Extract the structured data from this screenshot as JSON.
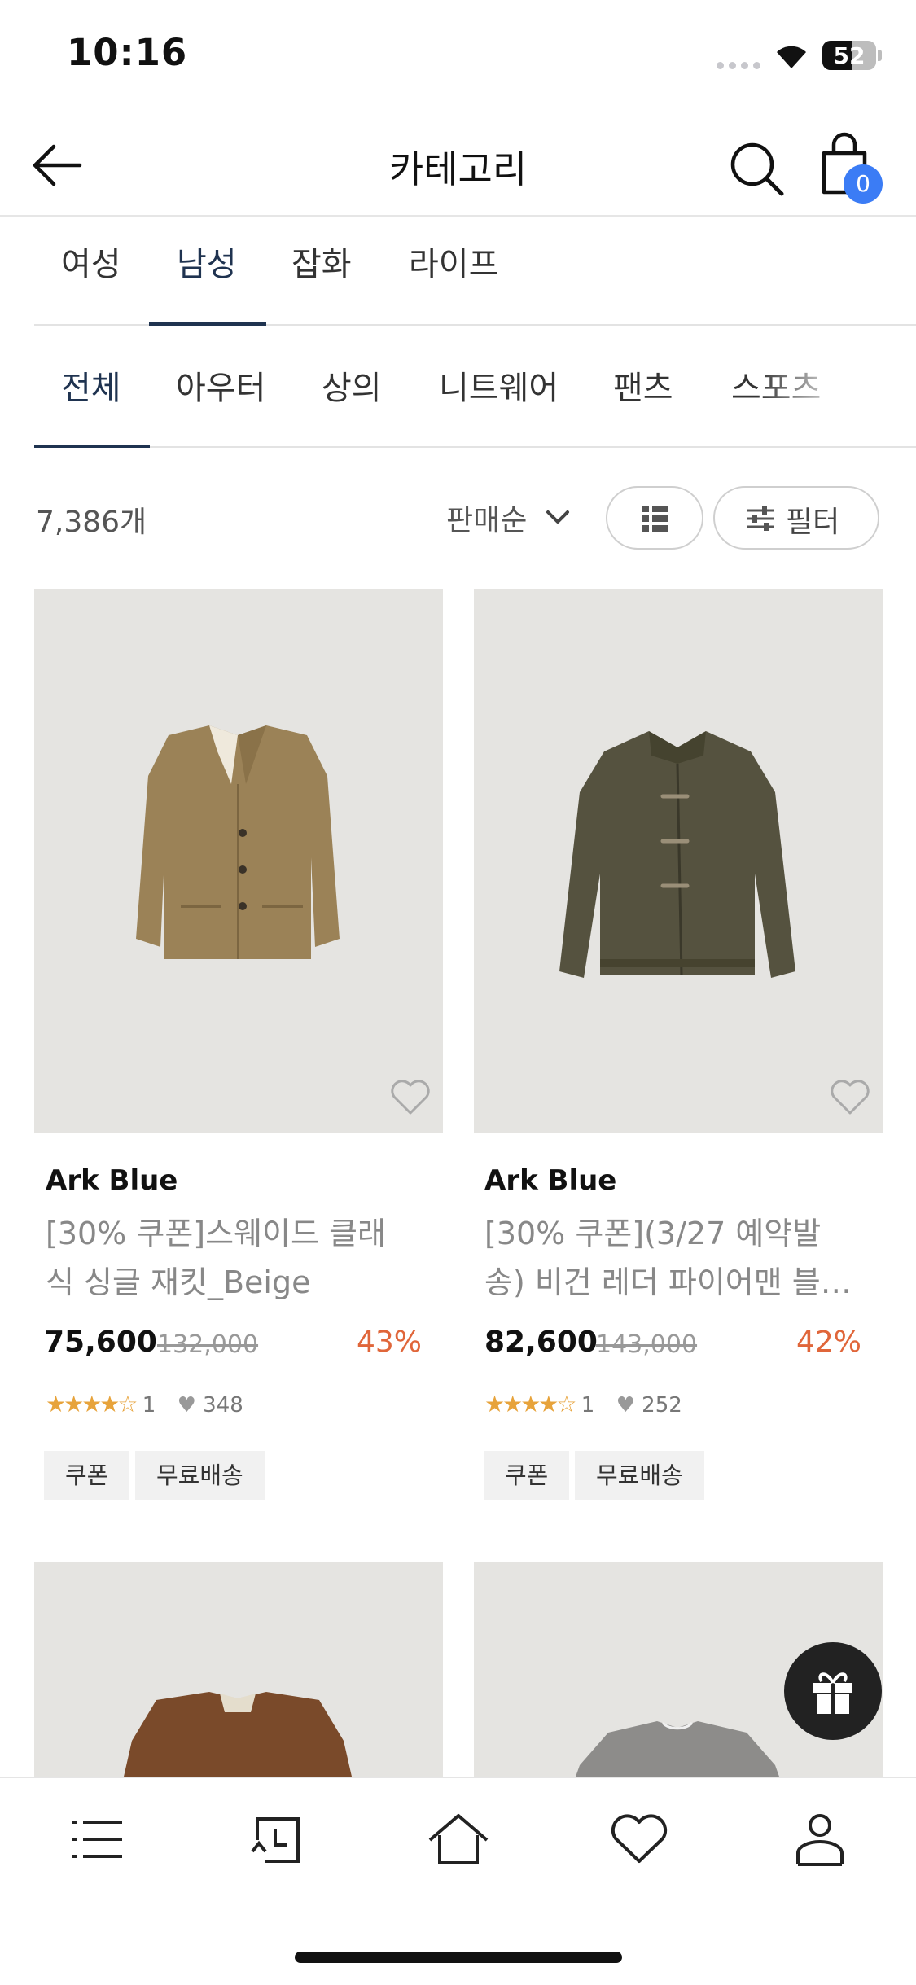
{
  "status_bar": {
    "time": "10:16",
    "battery": "52"
  },
  "header": {
    "title": "카테고리",
    "cart_count": "0"
  },
  "gender_tabs": [
    {
      "label": "여성"
    },
    {
      "label": "남성",
      "active": true
    },
    {
      "label": "잡화"
    },
    {
      "label": "라이프"
    }
  ],
  "category_tabs": [
    {
      "label": "전체",
      "active": true
    },
    {
      "label": "아우터"
    },
    {
      "label": "상의"
    },
    {
      "label": "니트웨어"
    },
    {
      "label": "팬츠"
    },
    {
      "label": "스포츠"
    }
  ],
  "toolbar": {
    "count": "7,386개",
    "sort_label": "판매순",
    "filter_label": "필터"
  },
  "products": [
    {
      "brand": "Ark Blue",
      "name_line1": "[30% 쿠폰]스웨이드 클래",
      "name_line2": "식 싱글 재킷_Beige",
      "price": "75,600",
      "original_price": "132,000",
      "discount": "43%",
      "stars": "★★★★☆",
      "review_count": "1",
      "likes": "348",
      "tags": [
        "쿠폰",
        "무료배송"
      ],
      "image": "beige-suede-blazer"
    },
    {
      "brand": "Ark Blue",
      "name_line1": "[30% 쿠폰](3/27 예약발",
      "name_line2": "송) 비건 레더 파이어맨 블…",
      "price": "82,600",
      "original_price": "143,000",
      "discount": "42%",
      "stars": "★★★★☆",
      "review_count": "1",
      "likes": "252",
      "tags": [
        "쿠폰",
        "무료배송"
      ],
      "image": "olive-fireman-jacket"
    },
    {
      "image": "brown-suede-jacket"
    },
    {
      "image": "grey-cardigan"
    }
  ],
  "colors": {
    "accent_blue": "#3b7cf5",
    "discount": "#e0663a",
    "star": "#e7a33b",
    "tab_indicator": "#1f3350"
  },
  "bottom_nav": [
    "menu-icon",
    "recent-icon",
    "home-icon",
    "heart-icon",
    "profile-icon"
  ]
}
